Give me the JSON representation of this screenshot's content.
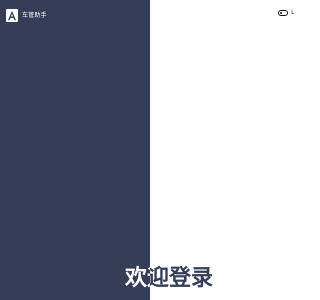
{
  "brand": {
    "name": "车管助手",
    "logo_icon": "letter-a-logo-icon"
  },
  "top_controls": {
    "toggle_icon": "toggle-switch-icon",
    "lang_label": "L"
  },
  "hero": {
    "title": "欢迎登录"
  },
  "colors": {
    "left_panel": "#363d57",
    "right_panel": "#ffffff",
    "title_dark": "#363d57"
  }
}
